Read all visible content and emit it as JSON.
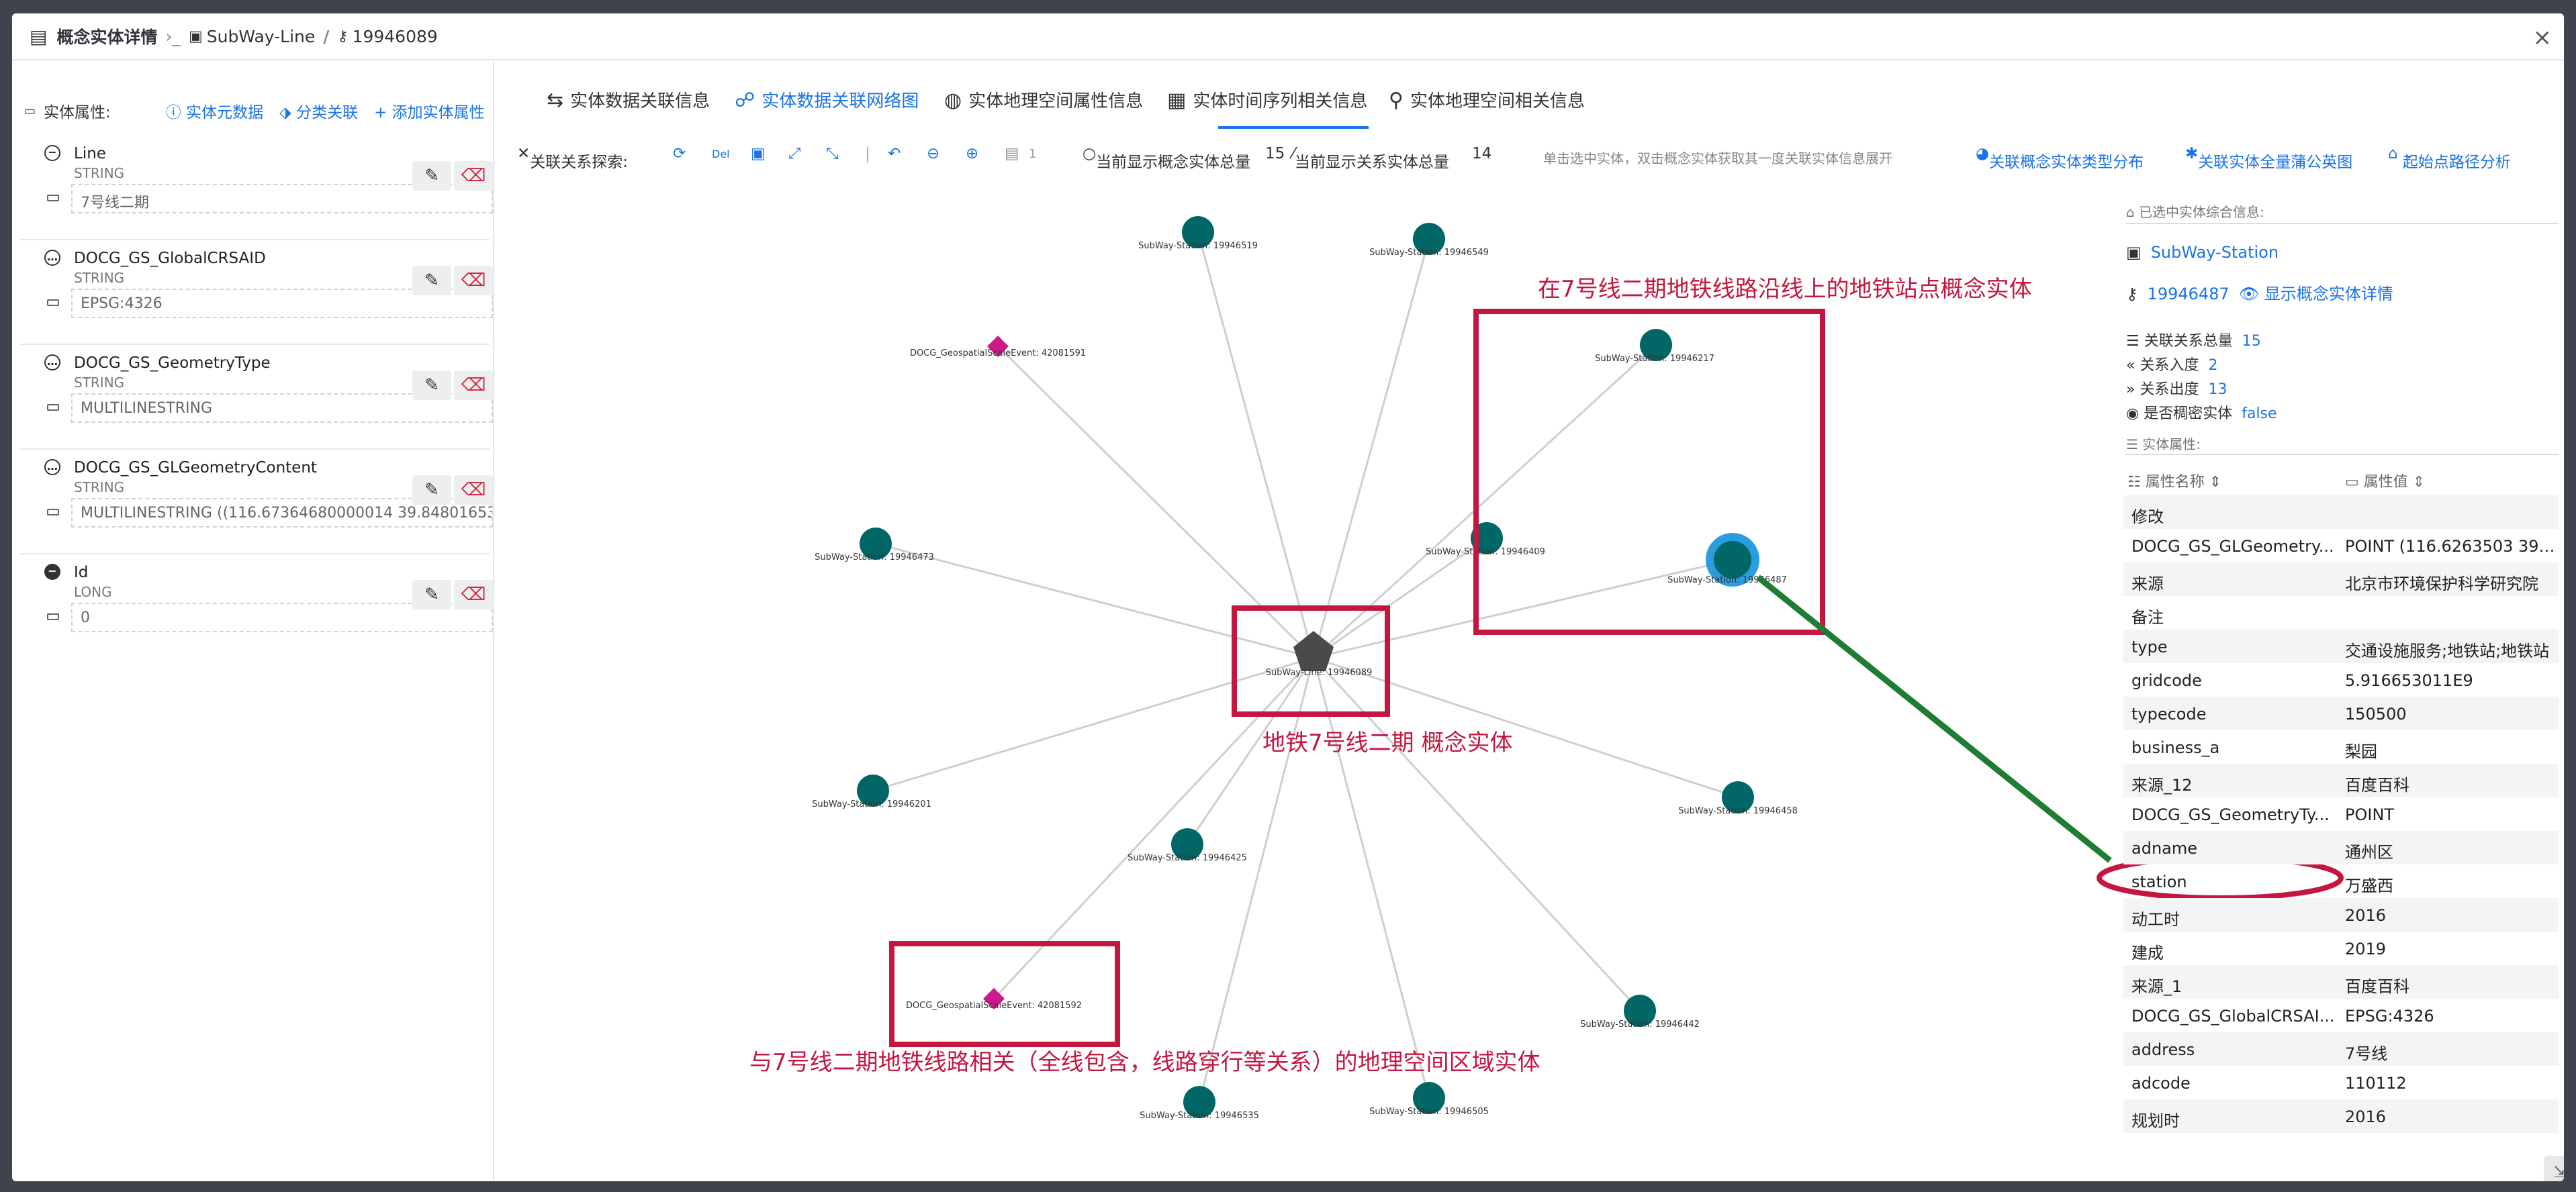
{
  "window": {
    "title": "概念实体详情",
    "breadcrumb_type": "SubWay-Line",
    "breadcrumb_id": "19946089",
    "close": "×"
  },
  "left": {
    "header": "实体属性:",
    "links": [
      "实体元数据",
      "分类关联",
      "添加实体属性"
    ],
    "properties": [
      {
        "name": "Line",
        "type": "STRING",
        "value": "7号线二期"
      },
      {
        "name": "DOCG_GS_GlobalCRSAID",
        "type": "STRING",
        "value": "EPSG:4326"
      },
      {
        "name": "DOCG_GS_GeometryType",
        "type": "STRING",
        "value": "MULTILINESTRING"
      },
      {
        "name": "DOCG_GS_GLGeometryContent",
        "type": "STRING",
        "value": "MULTILINESTRING ((116.67364680000014 39.84801653"
      },
      {
        "name": "Id",
        "type": "LONG",
        "value": "0"
      }
    ]
  },
  "tabs": [
    "实体数据关联信息",
    "实体数据关联网络图",
    "实体地理空间属性信息",
    "实体时间序列相关信息",
    "实体地理空间相关信息"
  ],
  "toolbar": {
    "explore": "关联关系探索:",
    "page": "1",
    "entity_total_label": "当前显示概念实体总量",
    "entity_total": "15",
    "rel_total_label": "当前显示关系实体总量",
    "rel_total": "14",
    "hint": "单击选中实体，双击概念实体获取其一度关联实体信息展开",
    "link1": "关联概念实体类型分布",
    "link2": "关联实体全量蒲公英图",
    "link3": "起始点路径分析"
  },
  "graph": {
    "center": {
      "label": "SubWay-Line: 19946089"
    },
    "nodes": [
      "SubWay-Station: 19946519",
      "SubWay-Station: 19946549",
      "SubWay-Station: 19946217",
      "SubWay-Station: 19946409",
      "SubWay-Station: 19946487",
      "SubWay-Station: 19946473",
      "SubWay-Station: 19946201",
      "SubWay-Station: 19946425",
      "SubWay-Station: 19946458",
      "SubWay-Station: 19946442",
      "SubWay-Station: 19946535",
      "SubWay-Station: 19946505",
      "DOCG_GeospatialScaleEvent: 42081591",
      "DOCG_GeospatialScaleEvent: 42081592"
    ],
    "annotations": [
      "在7号线二期地铁线路沿线上的地铁站点概念实体",
      "地铁7号线二期 概念实体",
      "与7号线二期地铁线路相关（全线包含，线路穿行等关系）的地理空间区域实体"
    ]
  },
  "detail": {
    "selected_label": "已选中实体综合信息:",
    "entity_type": "SubWay-Station",
    "entity_id": "19946487",
    "show_detail": "显示概念实体详情",
    "stats": [
      {
        "k": "关联关系总量",
        "v": "15"
      },
      {
        "k": "关系入度",
        "v": "2"
      },
      {
        "k": "关系出度",
        "v": "13"
      },
      {
        "k": "是否稠密实体",
        "v": "false"
      }
    ],
    "attr_label": "实体属性:",
    "col_name": "属性名称",
    "col_value": "属性值",
    "rows": [
      {
        "k": "修改",
        "v": ""
      },
      {
        "k": "DOCG_GS_GLGeometry...",
        "v": "POINT (116.6263503 39.8..."
      },
      {
        "k": "来源",
        "v": "北京市环境保护科学研究院"
      },
      {
        "k": "备注",
        "v": ""
      },
      {
        "k": "type",
        "v": "交通设施服务;地铁站;地铁站"
      },
      {
        "k": "gridcode",
        "v": "5.916653011E9"
      },
      {
        "k": "typecode",
        "v": "150500"
      },
      {
        "k": "business_a",
        "v": "梨园"
      },
      {
        "k": "来源_12",
        "v": "百度百科"
      },
      {
        "k": "DOCG_GS_GeometryTy...",
        "v": "POINT"
      },
      {
        "k": "adname",
        "v": "通州区"
      },
      {
        "k": "station",
        "v": "万盛西"
      },
      {
        "k": "动工时",
        "v": "2016"
      },
      {
        "k": "建成",
        "v": "2019"
      },
      {
        "k": "来源_1",
        "v": "百度百科"
      },
      {
        "k": "DOCG_GS_GlobalCRSAI...",
        "v": "EPSG:4326"
      },
      {
        "k": "address",
        "v": "7号线"
      },
      {
        "k": "adcode",
        "v": "110112"
      },
      {
        "k": "规划时",
        "v": "2016"
      }
    ]
  },
  "colors": {
    "accent": "#1a73e8",
    "annotation": "#c4173f",
    "node": "#006666",
    "event": "#cc1a8a",
    "green": "#1e7d32"
  }
}
